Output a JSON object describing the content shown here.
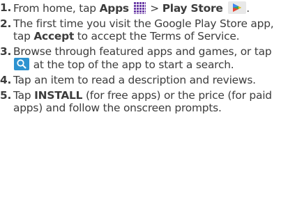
{
  "steps": [
    {
      "num": "1.",
      "parts": [
        "From home, tap ",
        "Apps",
        " > ",
        "Play Store",
        ""
      ]
    },
    {
      "num": "2.",
      "parts": [
        "The first time you visit the Google Play Store app, tap ",
        "Accept",
        " to accept the Terms of Service."
      ]
    },
    {
      "num": "3.",
      "parts": [
        "Browse through featured apps and games, or tap ",
        " at the top of the app to start a search."
      ]
    },
    {
      "num": "4.",
      "parts": [
        "Tap an item to read a description and reviews."
      ]
    },
    {
      "num": "5.",
      "parts": [
        "Tap ",
        "INSTALL",
        " (for free apps) or the price (for paid apps) and follow the onscreen prompts."
      ]
    }
  ],
  "icons": {
    "apps": "apps-grid-icon",
    "play_store": "play-store-icon",
    "search": "search-icon"
  },
  "colors": {
    "text": "#3c3c3c",
    "apps_icon": "#6d3fa8",
    "search_icon": "#2d93d0"
  }
}
